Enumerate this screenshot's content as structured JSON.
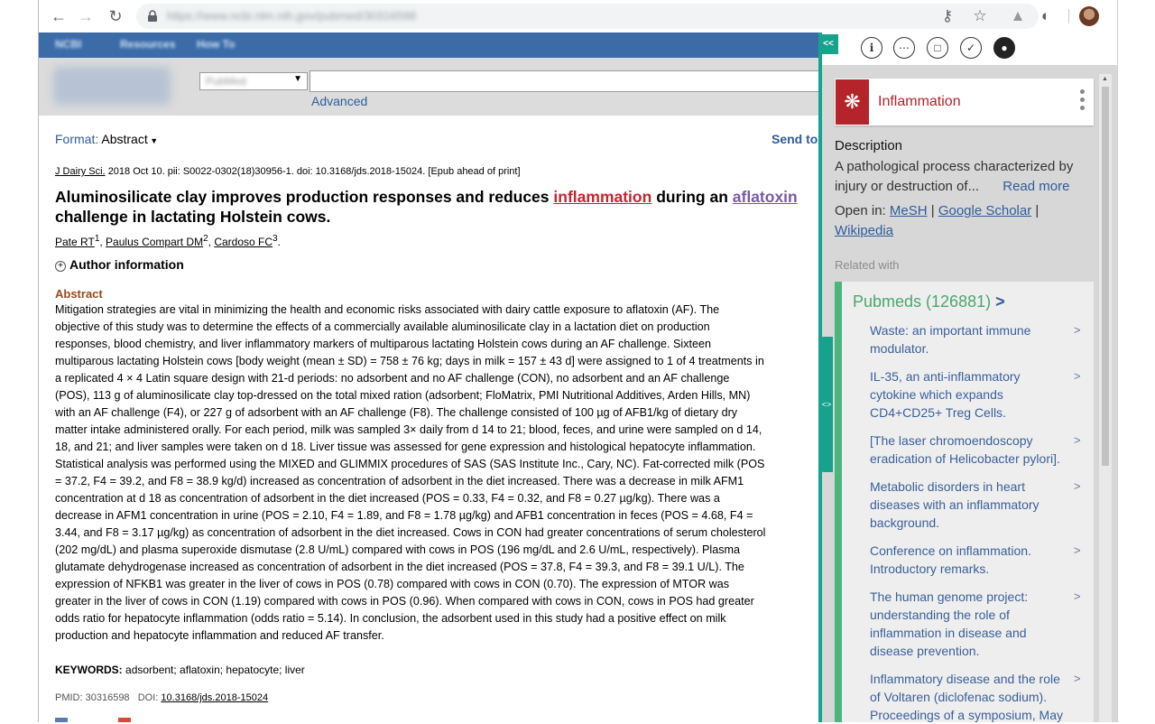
{
  "browser": {
    "url": "https://www.ncbi.nlm.nih.gov/pubmed/30316598"
  },
  "pubmed": {
    "search_db": "PubMed",
    "advanced_label": "Advanced",
    "format_label": "Format:",
    "format_value": "Abstract",
    "send_to": "Send to",
    "citation_journal": "J Dairy Sci.",
    "citation_rest": "2018 Oct 10. pii: S0022-0302(18)30956-1. doi: 10.3168/jds.2018-15024. [Epub ahead of print]",
    "title_part1": "Aluminosilicate clay improves production responses and reduces",
    "title_hl1": "inflammation",
    "title_part2": "during an",
    "title_hl2": "aflatoxin",
    "title_part3": "challenge in lactating Holstein cows.",
    "authors": [
      {
        "name": "Pate RT",
        "sup": "1"
      },
      {
        "name": "Paulus Compart DM",
        "sup": "2"
      },
      {
        "name": "Cardoso FC",
        "sup": "3"
      }
    ],
    "author_info": "Author information",
    "abstract_heading": "Abstract",
    "abstract_lines": [
      "Mitigation strategies are vital in minimizing the health and economic risks associated with dairy cattle exposure to aflatoxin (AF). The",
      "objective of this study was to determine the effects of a commercially available aluminosilicate clay in a lactation diet on production",
      "responses, blood chemistry, and liver inflammatory markers of multiparous lactating Holstein cows during an AF challenge. Sixteen",
      "multiparous lactating Holstein cows [body weight (mean ± SD) = 758 ± 76 kg; days in milk = 157 ± 43 d] were assigned to 1 of 4 treatments in",
      "a replicated 4 × 4 Latin square design with 21-d periods: no adsorbent and no AF challenge (CON), no adsorbent and an AF challenge",
      "(POS), 113 g of aluminosilicate clay top-dressed on the total mixed ration (adsorbent; FloMatrix, PMI Nutritional Additives, Arden Hills, MN)",
      "with an AF challenge (F4), or 227 g of adsorbent with an AF challenge (F8). The challenge consisted of 100 µg of AFB1/kg of dietary dry",
      "matter intake administered orally. For each period, milk was sampled 3× daily from d 14 to 21; blood, feces, and urine were sampled on d 14,",
      "18, and 21; and liver samples were taken on d 18. Liver tissue was assessed for gene expression and histological hepatocyte inflammation.",
      "Statistical analysis was performed using the MIXED and GLIMMIX procedures of SAS (SAS Institute Inc., Cary, NC). Fat-corrected milk (POS",
      "= 37.2, F4 = 39.2, and F8 = 38.9 kg/d) increased as concentration of adsorbent in the diet increased. There was a decrease in milk AFM1",
      "concentration at d 18 as concentration of adsorbent in the diet increased (POS = 0.33, F4 = 0.32, and F8 = 0.27 µg/kg). There was a",
      "decrease in AFM1 concentration in urine (POS = 2.10, F4 = 1.89, and F8 = 1.78 µg/kg) and AFB1 concentration in feces (POS = 4.68, F4 =",
      "3.44, and F8 = 3.17 µg/kg) as concentration of adsorbent in the diet increased. Cows in CON had greater concentrations of serum cholesterol",
      "(202 mg/dL) and plasma superoxide dismutase (2.8 U/mL) compared with cows in POS (196 mg/dL and 2.6 U/mL, respectively). Plasma",
      "glutamate dehydrogenase increased as concentration of adsorbent in the diet increased (POS = 37.8, F4 = 39.3, and F8 = 39.1 U/L). The",
      "expression of NFKB1 was greater in the liver of cows in POS (0.78) compared with cows in CON (0.70). The expression of MTOR was",
      "greater in the liver of cows in CON (1.19) compared with cows in POS (0.96). When compared with cows in CON, cows in POS had greater",
      "odds ratio for hepatocyte inflammation (odds ratio = 5.14). In conclusion, the adsorbent used in this study had a positive effect on milk",
      "production and hepatocyte inflammation and reduced AF transfer."
    ],
    "keywords_label": "KEYWORDS:",
    "keywords": "adsorbent; aflatoxin; hepatocyte; liver",
    "pmid": "PMID: 30316598",
    "doi_label": "DOI:",
    "doi": "10.3168/jds.2018-15024"
  },
  "panel": {
    "collapse_label": "<<",
    "entity_name": "Inflammation",
    "entity_color": "#b5232b",
    "description_heading": "Description",
    "description_text": "A pathological process characterized by injury or destruction of...",
    "read_more": "Read more",
    "open_in_label": "Open in:",
    "open_links": [
      "MeSH",
      "Google Scholar",
      "Wikipedia"
    ],
    "related_label": "Related with",
    "pubmeds_label": "Pubmeds (126881)",
    "pubmeds_arrow": ">",
    "pubmeds": [
      "Waste: an important immune modulator.",
      "IL-35, an anti-inflammatory cytokine which expands CD4+CD25+ Treg Cells.",
      "[The laser chromoendoscopy eradication of Helicobacter pylori].",
      "Metabolic disorders in heart diseases with an inflammatory background.",
      "Conference on inflammation. Introductory remarks.",
      "The human genome project: understanding the role of inflammation in disease and disease prevention.",
      "Inflammatory disease and the role of Voltaren (diclofenac sodium). Proceedings of a symposium, May"
    ],
    "accent_color": "#16a28b"
  }
}
